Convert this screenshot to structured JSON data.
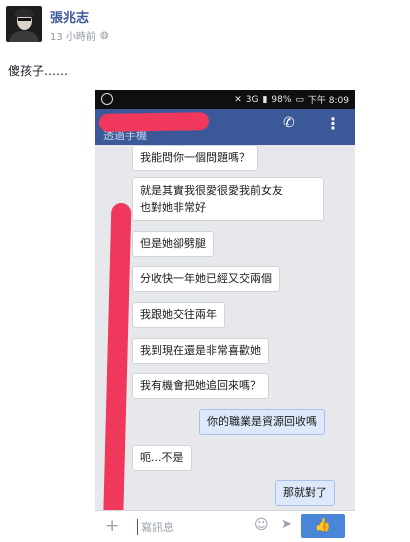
{
  "post": {
    "author": "張兆志",
    "time": "13 小時前",
    "text": "傻孩子……"
  },
  "phone": {
    "status": {
      "network": "3G",
      "battery": "98%",
      "clock": "下午 8:09"
    },
    "header": {
      "subtitle": "透過手機"
    },
    "messages": [
      {
        "text": "我能問你一個問題嗎？",
        "side": "in"
      },
      {
        "text": "就是其實我很愛很愛我前女友",
        "side": "in"
      },
      {
        "text": "也對她非常好",
        "side": "in"
      },
      {
        "text": "但是她卻劈腿",
        "side": "in"
      },
      {
        "text": "分收快一年她已經又交兩個",
        "side": "in"
      },
      {
        "text": "我跟她交往兩年",
        "side": "in"
      },
      {
        "text": "我到現在還是非常喜歡她",
        "side": "in"
      },
      {
        "text": "我有機會把她追回來嗎？",
        "side": "in"
      },
      {
        "text": "你的職業是資源回收嗎",
        "side": "out"
      },
      {
        "text": "呃...不是",
        "side": "in"
      },
      {
        "text": "那就對了",
        "side": "out"
      }
    ],
    "input": {
      "placeholder": "寫訊息"
    }
  },
  "colors": {
    "facebook_blue": "#3b5998",
    "redaction": "#f0375c",
    "like_button": "#4a86d8"
  },
  "icons": [
    "globe-icon",
    "whatsapp-icon",
    "phone-icon",
    "more-icon",
    "plus-icon",
    "emoji-icon",
    "send-icon",
    "like-icon"
  ]
}
